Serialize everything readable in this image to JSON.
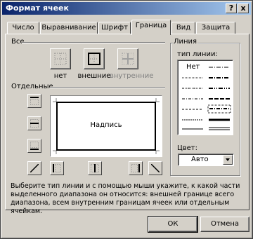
{
  "window": {
    "title": "Формат ячеек",
    "help_glyph": "?",
    "close_glyph": "x"
  },
  "tabs": [
    {
      "label": "Число"
    },
    {
      "label": "Выравнивание"
    },
    {
      "label": "Шрифт"
    },
    {
      "label": "Граница",
      "active": true
    },
    {
      "label": "Вид"
    },
    {
      "label": "Защита"
    }
  ],
  "presets": {
    "section_label": "Все",
    "none_label": "нет",
    "outline_label": "внешние",
    "inside_label": "внутренние"
  },
  "borders": {
    "section_label": "Отдельные",
    "preview_text": "Надпись"
  },
  "line": {
    "section_label": "Линия",
    "type_label": "тип линии:",
    "none_item": "Нет",
    "color_label": "Цвет:",
    "color_value": "Авто"
  },
  "description": "Выберите тип линии и с помощью мыши укажите, к какой части выделенного диапазона он относится: внешней границе всего диапазона, всем внутренним границам ячеек или отдельным ячейкам.",
  "buttons": {
    "ok": "ОК",
    "cancel": "Отмена"
  },
  "colors": {
    "titlebar_start": "#0a246a",
    "titlebar_end": "#a6caf0",
    "face": "#d4d0c8"
  }
}
